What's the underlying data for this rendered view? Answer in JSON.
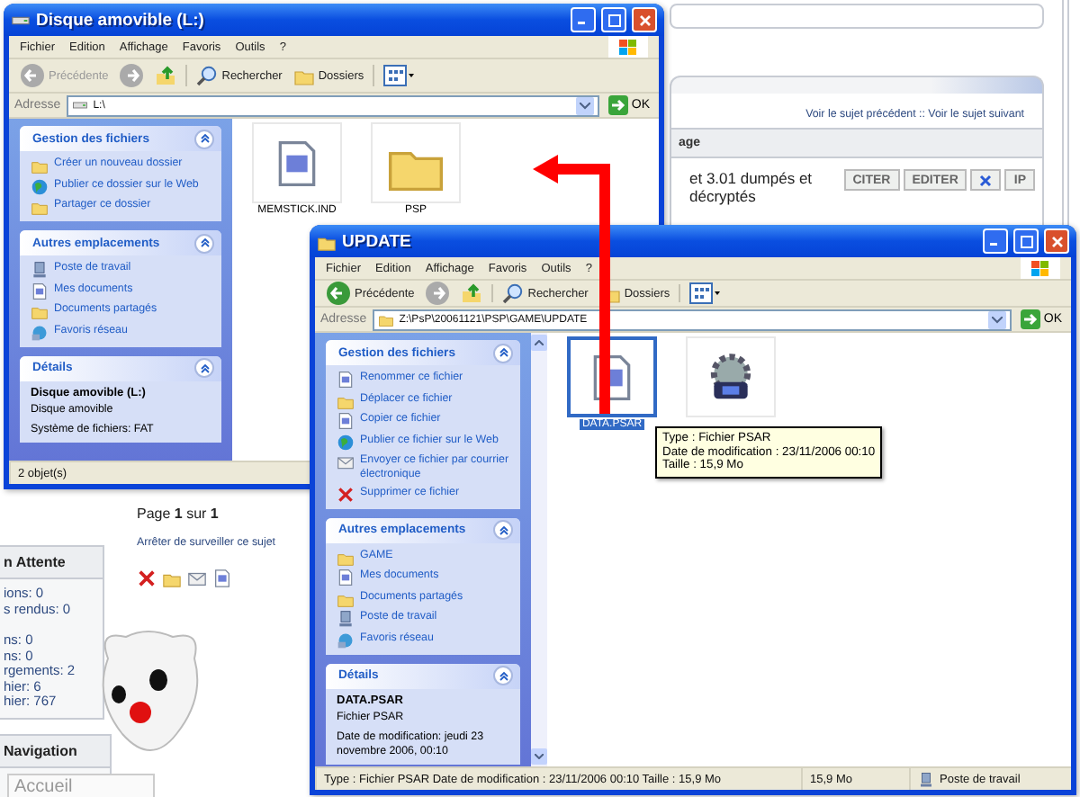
{
  "forum": {
    "nav_links": "Voir le sujet précédent :: Voir le sujet suivant",
    "column_header": "age",
    "post_text": "et 3.01 dumpés et décryptés",
    "post_buttons": [
      "CITER",
      "EDITER",
      "IP"
    ],
    "pagination": "Page **1** sur **1**",
    "watch_link": "Arrêter de surveiller ce sujet",
    "pending_panel": {
      "title": "n Attente",
      "rows": [
        "ions: 0",
        "s rendus: 0",
        "ns: 0",
        "ns: 0",
        "rgements: 2",
        "hier: 6",
        "hier: 767"
      ]
    },
    "navigation_panel": {
      "title": "Navigation",
      "button": "Accueil"
    }
  },
  "windows": [
    {
      "title": "Disque amovible (L:)",
      "kind": "drive",
      "menu": [
        "Fichier",
        "Edition",
        "Affichage",
        "Favoris",
        "Outils",
        "?"
      ],
      "toolbar": {
        "back": "Précédente",
        "search": "Rechercher",
        "folders": "Dossiers"
      },
      "address": {
        "label": "Adresse",
        "value": "L:\\",
        "go": "OK"
      },
      "task_panels": [
        {
          "title": "Gestion des fichiers",
          "items": [
            {
              "kind": "new-folder",
              "label": "Créer un nouveau dossier"
            },
            {
              "kind": "globe",
              "label": "Publier ce dossier sur le Web"
            },
            {
              "kind": "share",
              "label": "Partager ce dossier"
            }
          ]
        },
        {
          "title": "Autres emplacements",
          "items": [
            {
              "kind": "computer",
              "label": "Poste de travail"
            },
            {
              "kind": "documents",
              "label": "Mes documents"
            },
            {
              "kind": "folder",
              "label": "Documents partagés"
            },
            {
              "kind": "network",
              "label": "Favoris réseau"
            }
          ]
        }
      ],
      "details": {
        "title": "Détails",
        "name": "Disque amovible (L:)",
        "lines": [
          "Disque amovible",
          "Système de fichiers: FAT"
        ]
      },
      "files": [
        {
          "kind": "document",
          "name": "MEMSTICK.IND",
          "selected": false
        },
        {
          "kind": "folder",
          "name": "PSP",
          "selected": false
        }
      ],
      "status": [
        "2 objet(s)"
      ]
    },
    {
      "title": "UPDATE",
      "kind": "folder",
      "menu": [
        "Fichier",
        "Edition",
        "Affichage",
        "Favoris",
        "Outils",
        "?"
      ],
      "toolbar": {
        "back": "Précédente",
        "search": "Rechercher",
        "folders": "Dossiers"
      },
      "address": {
        "label": "Adresse",
        "value": "Z:\\PsP\\20061121\\PSP\\GAME\\UPDATE",
        "go": "OK"
      },
      "task_panels": [
        {
          "title": "Gestion des fichiers",
          "items": [
            {
              "kind": "rename",
              "label": "Renommer ce fichier"
            },
            {
              "kind": "move",
              "label": "Déplacer ce fichier"
            },
            {
              "kind": "copy",
              "label": "Copier ce fichier"
            },
            {
              "kind": "globe",
              "label": "Publier ce fichier sur le Web"
            },
            {
              "kind": "mail",
              "label": "Envoyer ce fichier par courrier électronique"
            },
            {
              "kind": "delete",
              "label": "Supprimer ce fichier"
            }
          ]
        },
        {
          "title": "Autres emplacements",
          "items": [
            {
              "kind": "folder",
              "label": "GAME"
            },
            {
              "kind": "documents",
              "label": "Mes documents"
            },
            {
              "kind": "folder",
              "label": "Documents partagés"
            },
            {
              "kind": "computer",
              "label": "Poste de travail"
            },
            {
              "kind": "network",
              "label": "Favoris réseau"
            }
          ]
        }
      ],
      "details": {
        "title": "Détails",
        "name": "DATA.PSAR",
        "lines": [
          "Fichier PSAR",
          "Date de modification: jeudi 23 novembre 2006, 00:10"
        ]
      },
      "files": [
        {
          "kind": "document",
          "name": "DATA.PSAR",
          "selected": true
        },
        {
          "kind": "program",
          "selected": false
        }
      ],
      "tooltip": [
        "Type : Fichier PSAR",
        "Date de modification : 23/11/2006 00:10",
        "Taille  : 15,9 Mo"
      ],
      "status": [
        "Type : Fichier PSAR Date de modification : 23/11/2006 00:10 Taille  : 15,9 Mo",
        "15,9 Mo",
        "Poste de travail"
      ]
    }
  ]
}
